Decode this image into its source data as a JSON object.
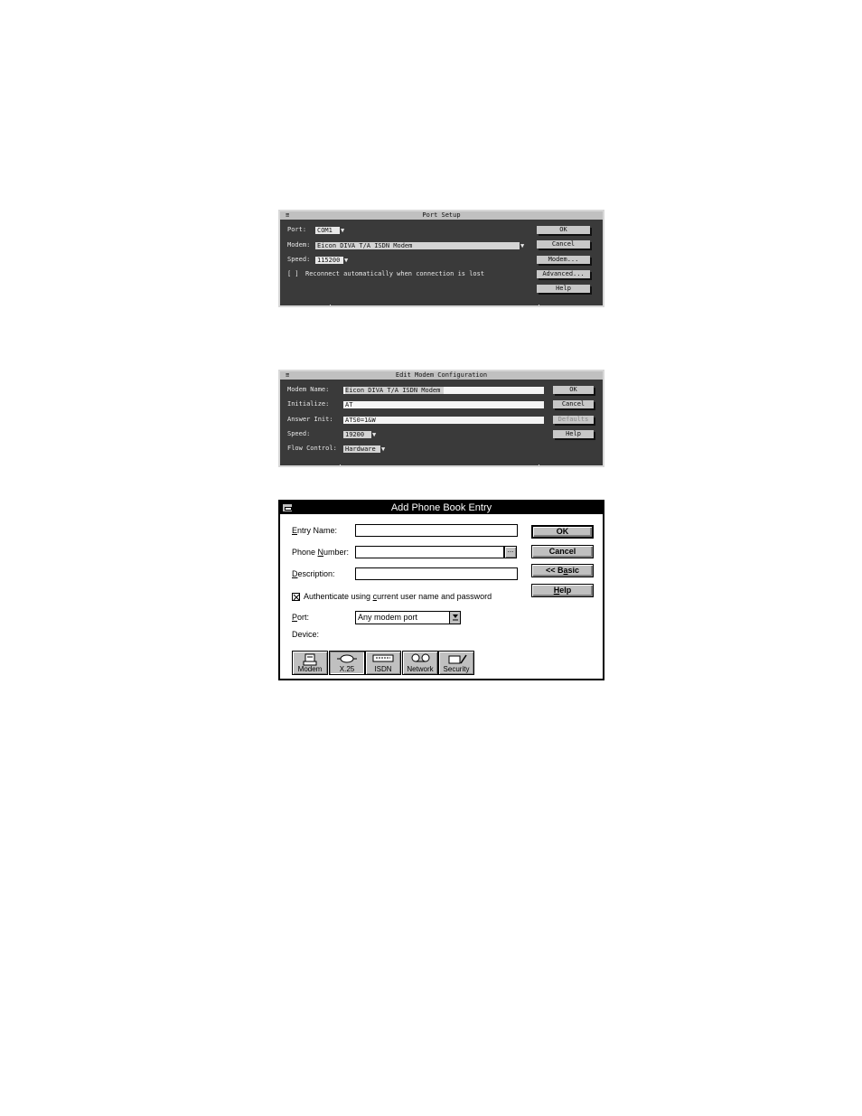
{
  "port_setup": {
    "title": "Port Setup",
    "sys_menu": "≡",
    "port_label": "Port:",
    "port_value": "COM1",
    "modem_label": "Modem:",
    "modem_value": "Eicon DIVA T/A ISDN Modem",
    "speed_label": "Speed:",
    "speed_value": "115200",
    "reconnect_checkbox": "[ ]",
    "reconnect_label": "Reconnect automatically when connection is lost",
    "buttons": {
      "ok": "OK",
      "cancel": "Cancel",
      "modem": "Modem...",
      "advanced": "Advanced...",
      "help": "Help"
    }
  },
  "edit_modem": {
    "title": "Edit Modem Configuration",
    "sys_menu": "≡",
    "modem_name_label": "Modem Name:",
    "modem_name_value": "Eicon DIVA T/A ISDN Modem",
    "initialize_label": "Initialize:",
    "initialize_value": "AT",
    "answer_init_label": "Answer Init:",
    "answer_init_value": "ATS0=1&W",
    "speed_label": "Speed:",
    "speed_value": "19200",
    "flow_control_label": "Flow Control:",
    "flow_control_value": "Hardware",
    "buttons": {
      "ok": "OK",
      "cancel": "Cancel",
      "defaults": "Defaults",
      "help": "Help"
    }
  },
  "add_phone_book": {
    "title": "Add Phone Book Entry",
    "entry_name_label_mnemonic": "E",
    "entry_name_label_rest": "ntry Name:",
    "entry_name_value": "",
    "phone_number_label_pre": "Phone ",
    "phone_number_label_mnemonic": "N",
    "phone_number_label_rest": "umber:",
    "phone_number_value": "",
    "phone_number_browse": "...",
    "description_label_mnemonic": "D",
    "description_label_rest": "escription:",
    "description_value": "",
    "authenticate_checked": true,
    "authenticate_label_pre": "Authenticate using ",
    "authenticate_label_mnemonic": "c",
    "authenticate_label_rest": "urrent user name and password",
    "port_label_mnemonic": "P",
    "port_label_rest": "ort:",
    "port_value": "Any modem port",
    "device_label": "Device:",
    "buttons": {
      "ok": "OK",
      "cancel": "Cancel",
      "basic_pre": "<< B",
      "basic_mnemonic": "a",
      "basic_rest": "sic",
      "help_mnemonic": "H",
      "help_rest": "elp"
    },
    "toolbar": [
      {
        "label": "Modem",
        "icon": "modem-icon"
      },
      {
        "label": "X.25",
        "icon": "x25-icon"
      },
      {
        "label": "ISDN",
        "icon": "isdn-icon"
      },
      {
        "label": "Network",
        "icon": "network-icon"
      },
      {
        "label": "Security",
        "icon": "security-icon"
      }
    ]
  }
}
